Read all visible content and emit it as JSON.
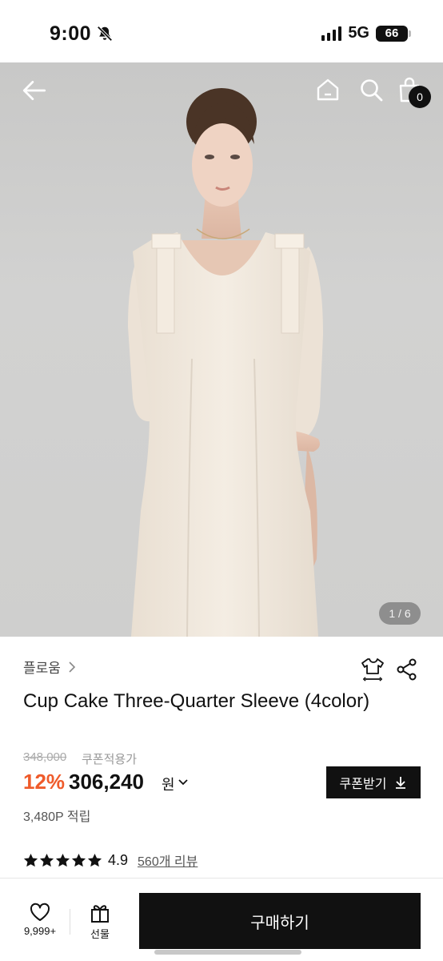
{
  "status_bar": {
    "time": "9:00",
    "network": "5G",
    "battery": "66"
  },
  "hero": {
    "pager": "1 / 6",
    "cart_count": "0"
  },
  "product": {
    "brand": "플로움",
    "title": "Cup Cake Three-Quarter Sleeve (4color)",
    "original_price": "348,000",
    "coupon_note": "쿠폰적용가",
    "discount": "12%",
    "price": "306,240",
    "currency": "원",
    "coupon_button": "쿠폰받기",
    "points": "3,480P 적립",
    "rating": "4.9",
    "stars_filled": 5,
    "review_link": "560개 리뷰"
  },
  "bottom_bar": {
    "like_count": "9,999+",
    "gift_label": "선물",
    "buy_label": "구매하기"
  },
  "colors": {
    "accent": "#ef5b2b",
    "primary_button": "#111111"
  },
  "icons": [
    "back-arrow-icon",
    "home-icon",
    "search-icon",
    "shopping-bag-icon",
    "fit-guide-icon",
    "share-icon",
    "heart-icon",
    "gift-icon",
    "download-icon",
    "star-icon",
    "chevron-right-icon",
    "chevron-down-icon",
    "bell-slash-icon"
  ]
}
